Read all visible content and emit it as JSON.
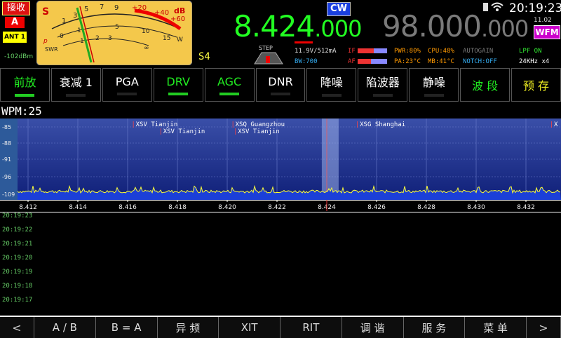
{
  "status": {
    "rx_label": "接收",
    "mode_letter": "A",
    "antenna": "ANT 1",
    "signal_dbm": "-102dBm",
    "s_reading": "S4"
  },
  "meter": {
    "s_label": "S",
    "p_label": "P",
    "swr_label": "SWR",
    "db_label": "dB",
    "w_label": "W",
    "s_scale": [
      "1",
      "3",
      "5",
      "7",
      "9",
      "+20",
      "+40",
      "+60"
    ],
    "p_scale": [
      "0",
      "1",
      "5",
      "10",
      "15"
    ],
    "swr_scale": [
      "1",
      "2",
      "3",
      "∞"
    ]
  },
  "vfo": {
    "mode": "CW",
    "freq_a_main": "8.424",
    "freq_a_small": ".000",
    "freq_b_main": "98.000",
    "freq_b_small": ".000",
    "step_label": "STEP",
    "voltage_current": "11.9V/512mA",
    "bandwidth": "BW:700",
    "if_label": "IF",
    "af_label": "AF",
    "pwr": "PWR:80%",
    "cpu": "CPU:48%",
    "autogain": "AUTOGAIN",
    "pa_temp": "PA:23°C",
    "mb_temp": "MB:41°C",
    "notch": "NOTCH:OFF",
    "lpf": "LPF ON",
    "span": "24KHz x4",
    "aux_mode": "WFM",
    "version": "11.02"
  },
  "clock": "20:19:23",
  "buttons": [
    {
      "label": "前放",
      "state": "on"
    },
    {
      "label": "衰减 1",
      "state": "off"
    },
    {
      "label": "PGA",
      "state": "off"
    },
    {
      "label": "DRV",
      "state": "on"
    },
    {
      "label": "AGC",
      "state": "on"
    },
    {
      "label": "DNR",
      "state": "off"
    },
    {
      "label": "降噪",
      "state": "off"
    },
    {
      "label": "陷波器",
      "state": "off"
    },
    {
      "label": "静噪",
      "state": "off"
    },
    {
      "label": "波 段",
      "state": "none"
    },
    {
      "label": "预 存",
      "state": "none"
    }
  ],
  "wpm": "WPM:25",
  "spectrum": {
    "db_ticks": [
      "-85",
      "-88",
      "-91",
      "-96",
      "-109"
    ],
    "freq_ticks": [
      "8.412",
      "8.414",
      "8.416",
      "8.418",
      "8.420",
      "8.422",
      "8.424",
      "8.426",
      "8.428",
      "8.430",
      "8.432"
    ],
    "stations": [
      {
        "name": "XSV Tianjin",
        "row": 1,
        "freq": 8.4163
      },
      {
        "name": "XSV Tianjin",
        "row": 2,
        "freq": 8.4174
      },
      {
        "name": "XSQ Guangzhou",
        "row": 1,
        "freq": 8.4203
      },
      {
        "name": "XSV Tianjin",
        "row": 2,
        "freq": 8.4204
      },
      {
        "name": "XSG Shanghai",
        "row": 1,
        "freq": 8.4253
      },
      {
        "name": "X",
        "row": 1,
        "freq": 8.4331
      }
    ]
  },
  "log_times": [
    "20:19:23",
    "20:19:22",
    "20:19:21",
    "20:19:20",
    "20:19:19",
    "20:19:18",
    "20:19:17"
  ],
  "bottom": {
    "left_arrow": "<",
    "ab": "A / B",
    "a_eq_b": "B = A",
    "split": "异 频",
    "xit": "XIT",
    "rit": "RIT",
    "tune": "调 谐",
    "service": "服 务",
    "menu": "菜 单",
    "right_arrow": ">"
  },
  "colors": {
    "freq_a": "#22ff22",
    "freq_b": "#7a7a7a",
    "spectrum_bg": "#1c2d8a",
    "trace": "#ffff33",
    "accent_green": "#22cc22"
  }
}
